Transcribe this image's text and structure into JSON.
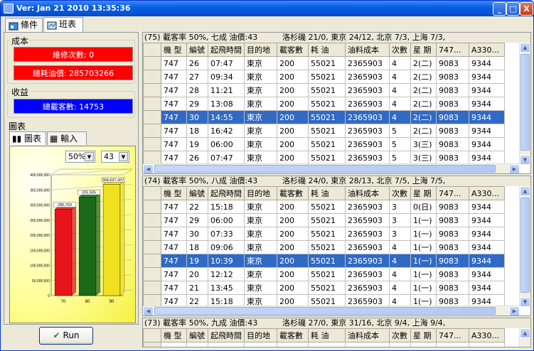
{
  "window": {
    "title": "Ver: Jan 21 2010 13:35:36",
    "min": "_",
    "max": "□",
    "close": "X"
  },
  "tabs": [
    {
      "label": "條件"
    },
    {
      "label": "班表"
    }
  ],
  "cost": {
    "label": "成本",
    "maintenance": "維修次數: 0",
    "fuel": "總耗油價: 285703266"
  },
  "revenue": {
    "label": "收益",
    "passengers": "總載客數: 14753"
  },
  "chart_panel": {
    "label": "圖表",
    "tab_chart": "圖表",
    "tab_input": "輸入",
    "load_pct": "50%",
    "fuel_price": "43"
  },
  "run_label": "Run",
  "colors": {
    "cost_bar": "#ff0000",
    "revenue_bar": "#0000ff",
    "selected_row": "#316ac5"
  },
  "chart_data": {
    "type": "bar",
    "categories": [
      "70",
      "80",
      "90"
    ],
    "values": [
      285703266,
      326505000,
      368697437
    ],
    "data_labels": [
      "285,703",
      "326,505",
      "368,697,437"
    ],
    "bar_colors": [
      "#e8141b",
      "#1a6a1a",
      "#f0e020"
    ],
    "ylim": [
      0,
      400000000
    ],
    "yticks": [
      "0",
      "50,000,000",
      "100,000,000",
      "150,000,000",
      "200,000,000",
      "250,000,000",
      "300,000,000",
      "350,000,000",
      "400,000,000"
    ]
  },
  "columns": [
    "機 型",
    "編號",
    "起飛時間",
    "目的地",
    "載客數",
    "耗 油",
    "油料成本",
    "次數",
    "星 期",
    "747...",
    "A330..."
  ],
  "panes": [
    {
      "header": "(75) 載客率 50%, 七成 油價:43",
      "header_right": "洛杉磯 21/0, 東京 24/12, 北京 7/3, 上海 7/3,",
      "selected": 4,
      "rows": [
        [
          "747",
          "26",
          "07:47",
          "東京",
          "200",
          "55021",
          "2365903",
          "4",
          "2(二)",
          "9083",
          "9344"
        ],
        [
          "747",
          "27",
          "09:34",
          "東京",
          "200",
          "55021",
          "2365903",
          "4",
          "2(二)",
          "9083",
          "9344"
        ],
        [
          "747",
          "28",
          "11:21",
          "東京",
          "200",
          "55021",
          "2365903",
          "4",
          "2(二)",
          "9083",
          "9344"
        ],
        [
          "747",
          "29",
          "13:08",
          "東京",
          "200",
          "55021",
          "2365903",
          "4",
          "2(二)",
          "9083",
          "9344"
        ],
        [
          "747",
          "30",
          "14:55",
          "東京",
          "200",
          "55021",
          "2365903",
          "4",
          "2(二)",
          "9083",
          "9344"
        ],
        [
          "747",
          "18",
          "16:42",
          "東京",
          "200",
          "55021",
          "2365903",
          "5",
          "2(二)",
          "9083",
          "9344"
        ],
        [
          "747",
          "19",
          "06:00",
          "東京",
          "200",
          "55021",
          "2365903",
          "5",
          "3(三)",
          "9083",
          "9344"
        ],
        [
          "747",
          "26",
          "07:47",
          "東京",
          "200",
          "55021",
          "2365903",
          "5",
          "3(三)",
          "9083",
          "9344"
        ]
      ]
    },
    {
      "header": "(74) 載客率 50%, 八成 油價:43",
      "header_right": "洛杉磯 24/0, 東京 28/13, 北京 7/5, 上海 7/5,",
      "selected": 4,
      "rows": [
        [
          "747",
          "22",
          "15:18",
          "東京",
          "200",
          "55021",
          "2365903",
          "3",
          "0(日)",
          "9083",
          "9344"
        ],
        [
          "747",
          "29",
          "06:00",
          "東京",
          "200",
          "55021",
          "2365903",
          "3",
          "1(一)",
          "9083",
          "9344"
        ],
        [
          "747",
          "30",
          "07:33",
          "東京",
          "200",
          "55021",
          "2365903",
          "3",
          "1(一)",
          "9083",
          "9344"
        ],
        [
          "747",
          "18",
          "09:06",
          "東京",
          "200",
          "55021",
          "2365903",
          "4",
          "1(一)",
          "9083",
          "9344"
        ],
        [
          "747",
          "19",
          "10:39",
          "東京",
          "200",
          "55021",
          "2365903",
          "4",
          "1(一)",
          "9083",
          "9344"
        ],
        [
          "747",
          "20",
          "12:12",
          "東京",
          "200",
          "55021",
          "2365903",
          "4",
          "1(一)",
          "9083",
          "9344"
        ],
        [
          "747",
          "21",
          "13:45",
          "東京",
          "200",
          "55021",
          "2365903",
          "4",
          "1(一)",
          "9083",
          "9344"
        ],
        [
          "747",
          "22",
          "15:18",
          "東京",
          "200",
          "55021",
          "2365903",
          "4",
          "1(一)",
          "9083",
          "9344"
        ]
      ]
    },
    {
      "header": "(73) 載客率 50%, 九成 油價:43",
      "header_right": "洛杉磯 27/0, 東京 31/16, 北京 9/4, 上海 9/4,",
      "selected": -1,
      "rows": []
    }
  ]
}
